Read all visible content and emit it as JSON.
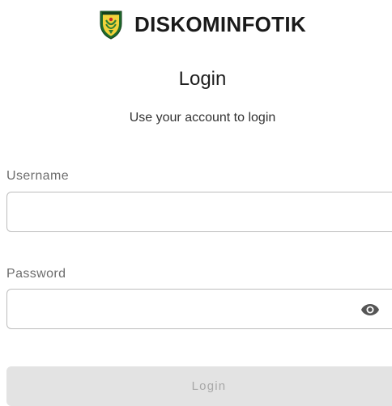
{
  "brand": {
    "name": "DISKOMINFOTIK",
    "logo_icon": "regional-emblem-shield-icon"
  },
  "login": {
    "title": "Login",
    "subtitle": "Use your account to login",
    "username_label": "Username",
    "username_value": "",
    "password_label": "Password",
    "password_value": "",
    "password_toggle_icon": "eye-icon",
    "submit_label": "Login"
  },
  "colors": {
    "emblem_green": "#1f6b2c",
    "emblem_yellow": "#f2d23a",
    "border": "#bdbdbd",
    "disabled_button_bg": "#e3e3e3",
    "disabled_button_text": "#a8a8a8"
  }
}
